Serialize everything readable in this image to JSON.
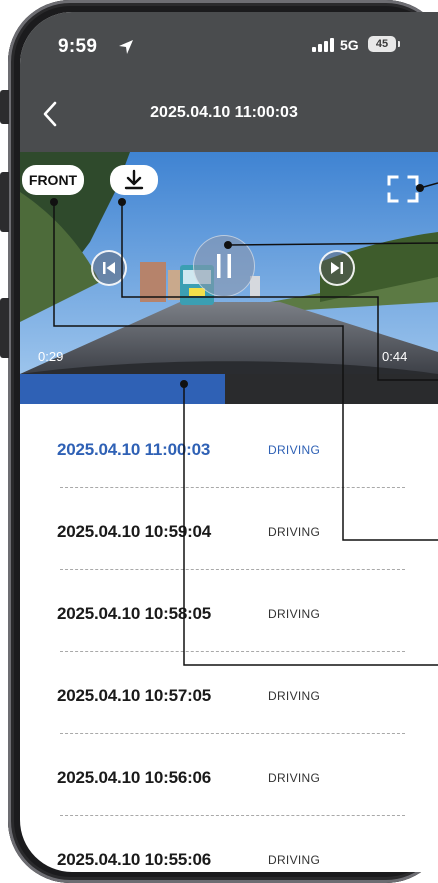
{
  "status_bar": {
    "time": "9:59",
    "network": "5G",
    "battery": "45"
  },
  "nav": {
    "title": "2025.04.10 11:00:03"
  },
  "video": {
    "camera_label": "FRONT",
    "elapsed": "0:29",
    "duration": "0:44",
    "progress_fraction": 0.49
  },
  "recordings": [
    {
      "date": "2025.04.10 11:00:03",
      "status": "DRIVING"
    },
    {
      "date": "2025.04.10 10:59:04",
      "status": "DRIVING"
    },
    {
      "date": "2025.04.10 10:58:05",
      "status": "DRIVING"
    },
    {
      "date": "2025.04.10 10:57:05",
      "status": "DRIVING"
    },
    {
      "date": "2025.04.10 10:56:06",
      "status": "DRIVING"
    },
    {
      "date": "2025.04.10 10:55:06",
      "status": "DRIVING"
    }
  ],
  "colors": {
    "accent": "#2f61b5",
    "header": "#4a4c4e",
    "progress_track": "#2a2b2d"
  }
}
